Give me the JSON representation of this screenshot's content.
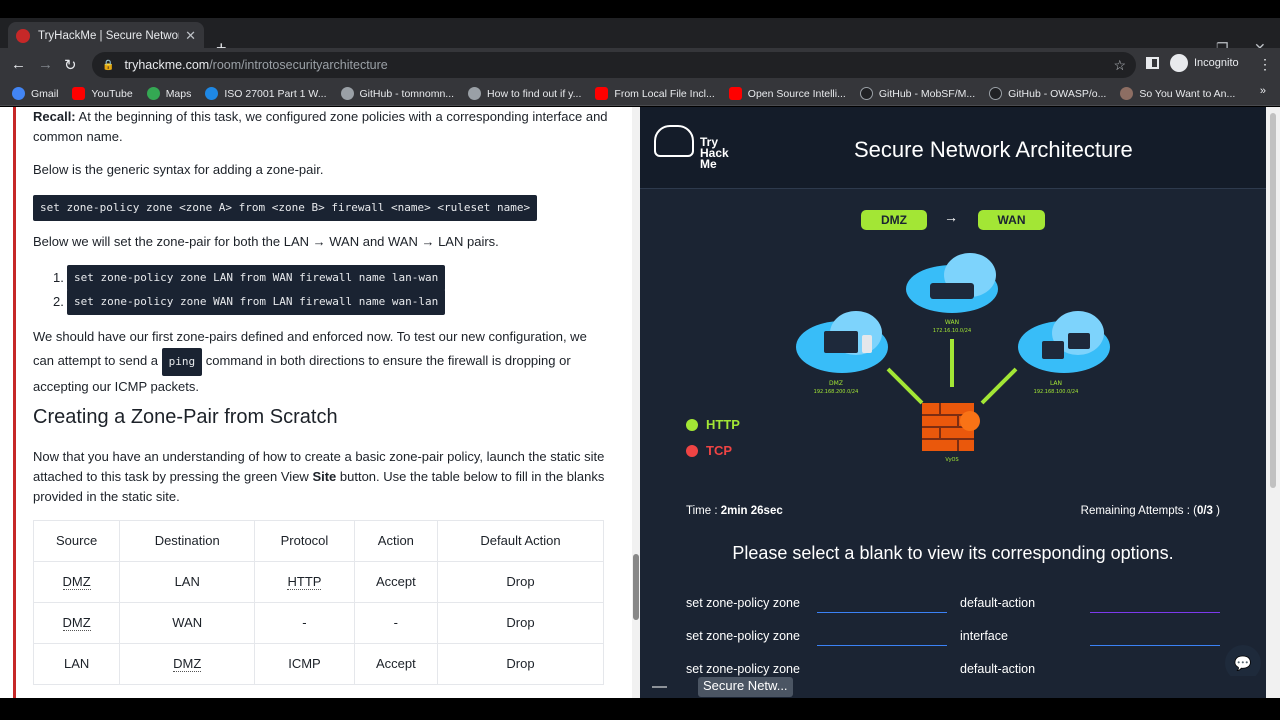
{
  "browser": {
    "tab_title": "TryHackMe | Secure Network Arc",
    "url_host": "tryhackme.com",
    "url_path": "/room/introtosecurityarchitecture",
    "profile": "Incognito",
    "bookmarks": [
      {
        "label": "Gmail",
        "color": "#4285f4"
      },
      {
        "label": "YouTube",
        "color": "#ff0000"
      },
      {
        "label": "Maps",
        "color": "#34a853"
      },
      {
        "label": "ISO 27001 Part 1 W...",
        "color": "#1e88e5"
      },
      {
        "label": "GitHub - tomnomn...",
        "color": "#9aa0a6"
      },
      {
        "label": "How to find out if y...",
        "color": "#9aa0a6"
      },
      {
        "label": "From Local File Incl...",
        "color": "#ff0000"
      },
      {
        "label": "Open Source Intelli...",
        "color": "#ff0000"
      },
      {
        "label": "GitHub - MobSF/M...",
        "color": "#202124"
      },
      {
        "label": "GitHub - OWASP/o...",
        "color": "#202124"
      },
      {
        "label": "So You Want to An...",
        "color": "#8d6e63"
      }
    ]
  },
  "article": {
    "recall_label": "Recall:",
    "recall_text": " At the beginning of this task, we configured zone policies with a corresponding interface and common name.",
    "syntax_intro": "Below is the generic syntax for adding a zone-pair.",
    "syntax_code": "set zone-policy zone <zone A> from <zone B> firewall <name> <ruleset name>",
    "pairs_intro": "Below we will set the zone-pair for both the LAN → WAN and WAN → LAN pairs.",
    "steps": [
      {
        "num": "1.",
        "code": "set zone-policy zone LAN from WAN firewall name lan-wan"
      },
      {
        "num": "2.",
        "code": "set zone-policy zone WAN from LAN firewall name wan-lan"
      }
    ],
    "test_part1": "We should have our first zone-pairs defined and enforced now. To test our new configuration, we can attempt to send a ",
    "test_code": "ping",
    "test_part2": " command in both directions to ensure the firewall is dropping or accepting our ICMP packets.",
    "heading": "Creating a Zone-Pair from Scratch",
    "scratch_part1": "Now that you have an understanding of how to create a basic zone-pair policy, launch the static site attached to this task by pressing the green View ",
    "scratch_bold": "Site",
    "scratch_part2": " button. Use the table below to fill in the blanks provided in the static site.",
    "table_headers": [
      "Source",
      "Destination",
      "Protocol",
      "Action",
      "Default Action"
    ],
    "table_rows": [
      [
        "DMZ",
        "LAN",
        "HTTP",
        "Accept",
        "Drop"
      ],
      [
        "DMZ",
        "WAN",
        "-",
        "-",
        "Drop"
      ],
      [
        "LAN",
        "DMZ",
        "ICMP",
        "Accept",
        "Drop"
      ]
    ]
  },
  "site": {
    "logo_text": "Try Hack Me",
    "title": "Secure Network Architecture",
    "pair_from": "DMZ",
    "pair_arrow": "→",
    "pair_to": "WAN",
    "legend": [
      {
        "label": "HTTP",
        "color": "#a3e635"
      },
      {
        "label": "TCP",
        "color": "#ef4444"
      }
    ],
    "diagram": {
      "wan": "WAN",
      "wan_net": "172.16.10.0/24",
      "dmz": "DMZ",
      "dmz_net": "192.168.200.0/24",
      "lan": "LAN",
      "lan_net": "192.168.100.0/24",
      "firewall": "VyOS"
    },
    "time_label": "Time : ",
    "time_value": "2min 26sec",
    "remaining_label": "Remaining Attempts : (",
    "remaining_value": "0/3",
    "remaining_close": " )",
    "prompt": "Please select a blank to view its corresponding options.",
    "rows": [
      {
        "a": "set zone-policy zone",
        "b": "default-action"
      },
      {
        "a": "set zone-policy zone",
        "b": "interface"
      },
      {
        "a": "set zone-policy zone",
        "b": "default-action"
      }
    ],
    "minimized_label": "Secure Netw..."
  }
}
